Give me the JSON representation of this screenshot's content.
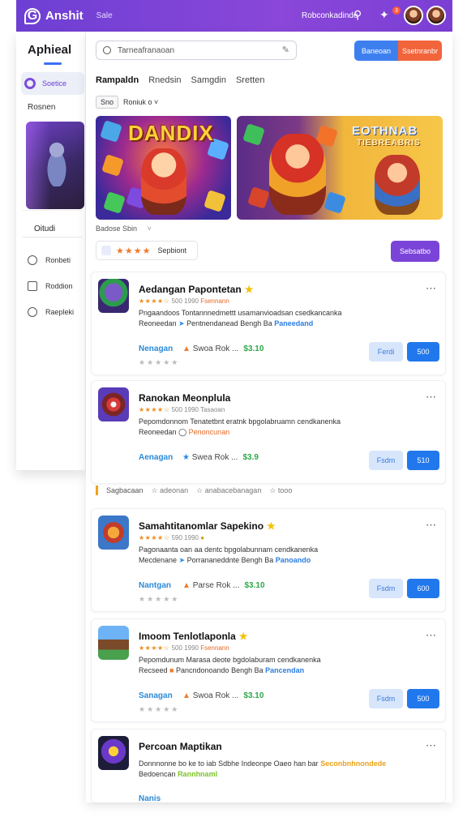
{
  "topbar": {
    "app_name": "Anshit",
    "app_sub": "Sale",
    "link": "Robconkadinde",
    "notif_count": "3"
  },
  "sidebar": {
    "title": "Aphieal",
    "active_item": "Soetice",
    "section": "Rosnen",
    "card_label": "Oitudi",
    "nav": [
      "Ronbeti",
      "Roddion",
      "Raepleki"
    ]
  },
  "main": {
    "search_placeholder": "Tarneafranaoan",
    "btn_blue": "Baneoan",
    "btn_orange": "Ssetnranbr",
    "tabs": [
      "Rampaldn",
      "Rnedsin",
      "Samgdin",
      "Sretten"
    ],
    "filter_box": "Sno",
    "filter_label": "Roniuk ο ˅",
    "banner1_title": "DANDIX",
    "banner2_title": "EOTHNAB",
    "banner2_sub": "TIEBREABRIS",
    "meta": "Badose Sbin",
    "rating_label": "Sepbiont",
    "btn_purple": "Sebsatbo"
  },
  "cards": [
    {
      "title": "Aedangan Papontetan",
      "rate": "★★★★☆",
      "rate_meta": "500 1990",
      "rate_tag": "Fsennann",
      "desc_a": "Pngaandoos Tontannnedmettt usamanvioadsan csedkancanka",
      "desc_b": "Reoneedan",
      "desc_c": "Pentnendanead Bengh Ba",
      "desc_hl": "Paneedand",
      "link": "Nenagan",
      "mid": "Swoa Rok ...",
      "price": "$3.10",
      "btn_light": "Ferdi",
      "btn_dark": "500"
    },
    {
      "title": "Ranokan Meonplula",
      "rate": "★★★★☆",
      "rate_meta": "500 1990",
      "rate_tag": "Tasaoan",
      "desc_a": "Pepomdonnom Tenatetbnt eratnk bpgolabruamn cendkanenka",
      "desc_b": "Reoneedan",
      "desc_c": "",
      "desc_hl": "Penoncunan",
      "link": "Aenagan",
      "mid": "Swea Rok ...",
      "price": "$3.9",
      "btn_light": "Fsdm",
      "btn_dark": "510"
    },
    {
      "title": "Samahtitanomlar Sapekino",
      "rate": "★★★★☆",
      "rate_meta": "590 1990",
      "rate_tag": "",
      "desc_a": "Pagonaanta oan aa dentc bpgolabunnam cendkanenka",
      "desc_b": "Mecdenane",
      "desc_c": "Porrananeddnte Bengh Ba",
      "desc_hl": "Panoando",
      "link": "Nantgan",
      "mid": "Parse Rok ...",
      "price": "$3.10",
      "btn_light": "Fsdm",
      "btn_dark": "600"
    },
    {
      "title": "Imoom Tenlotlaponla",
      "rate": "★★★★☆",
      "rate_meta": "500 1990",
      "rate_tag": "Fsennann",
      "desc_a": "Pepomdunum Marasa deote bgdolaburam cendkanenka",
      "desc_b": "Recseed",
      "desc_c": "Pancndonoando Bengh Ba",
      "desc_hl": "Pancendan",
      "link": "Sanagan",
      "mid": "Swoa Rok ...",
      "price": "$3.10",
      "btn_light": "Fsdm",
      "btn_dark": "500"
    },
    {
      "title": "Percoan Maptikan",
      "desc_a": "Donnnonne bo ke to iab Sdbhe Indeonpe Oaeo han bar",
      "desc_hl": "Seconbnhnondede",
      "desc_b": "Bedoencan",
      "desc_hl2": "Rannhnaml",
      "link": "Nanis"
    }
  ],
  "section": {
    "label": "Sagbacaan",
    "items": [
      "adeonan",
      "anabacebanagan",
      "tooo"
    ]
  },
  "colors": {
    "primary_purple": "#7b44d8",
    "accent_blue": "#2178ec",
    "accent_orange": "#f2643a"
  }
}
